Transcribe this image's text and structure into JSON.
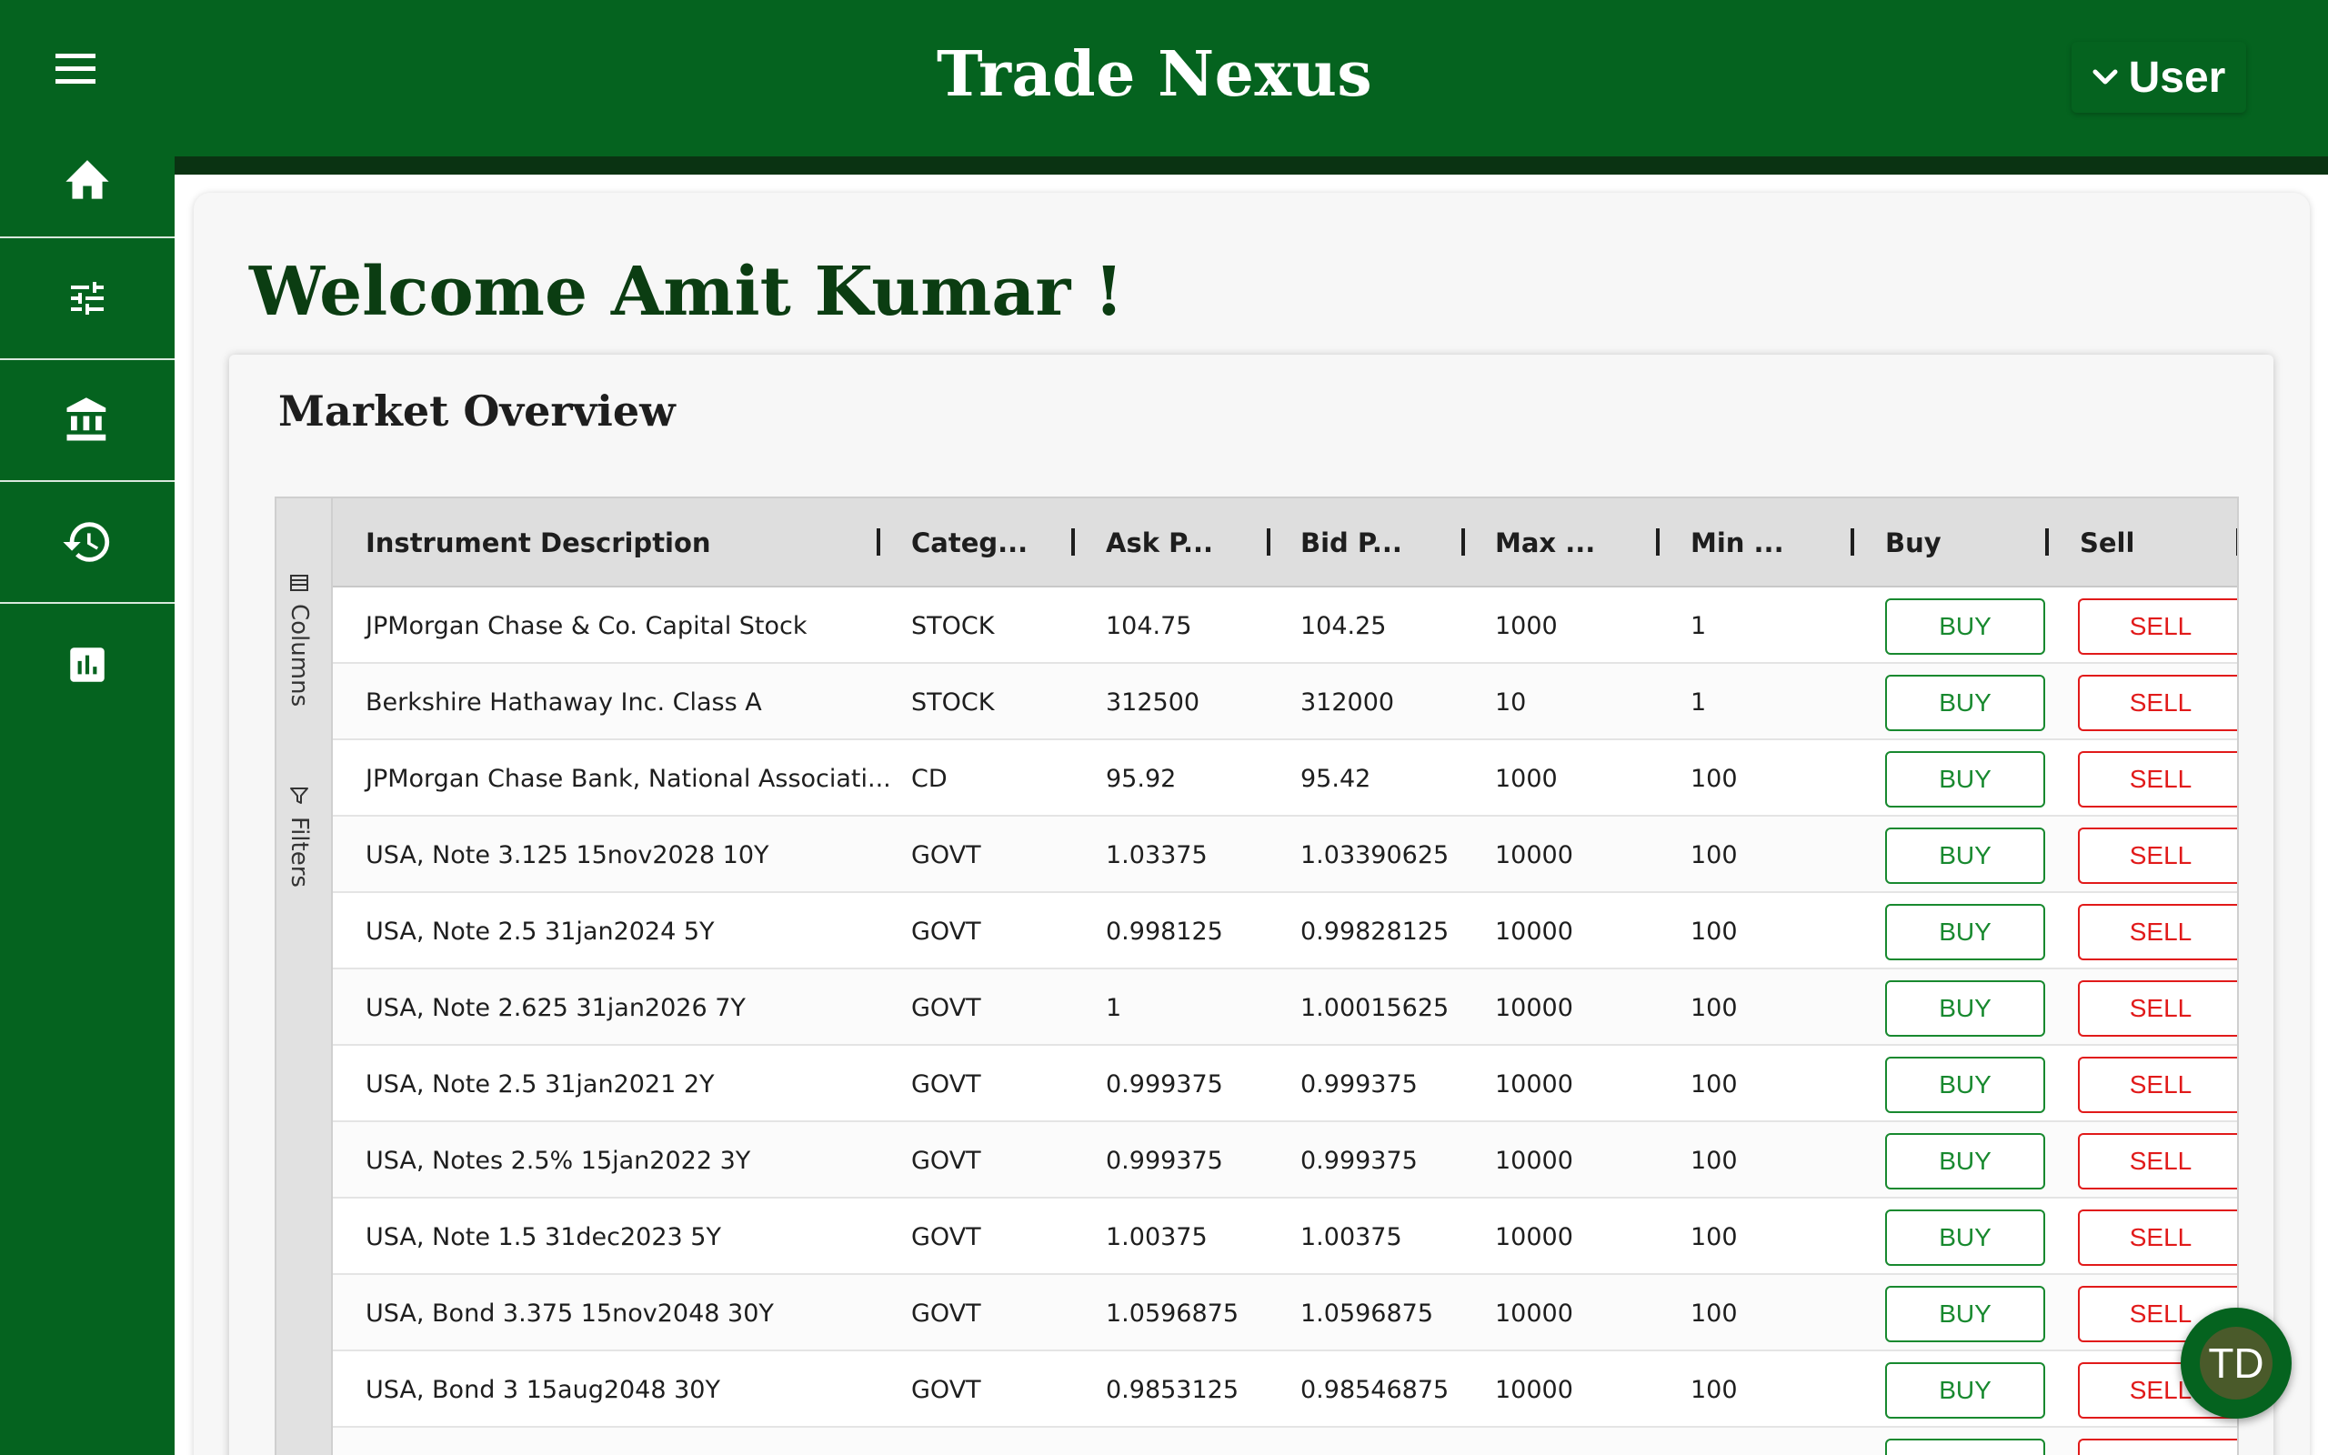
{
  "app": {
    "title": "Trade Nexus"
  },
  "user_menu": {
    "label": "User",
    "icon": "chevron-down-icon"
  },
  "sidebar": {
    "items": [
      {
        "name": "menu",
        "icon": "menu-icon"
      },
      {
        "name": "home",
        "icon": "home-icon"
      },
      {
        "name": "tune",
        "icon": "sliders-icon"
      },
      {
        "name": "bank",
        "icon": "bank-icon"
      },
      {
        "name": "history",
        "icon": "history-icon"
      },
      {
        "name": "reports",
        "icon": "bar-chart-icon"
      }
    ]
  },
  "welcome": {
    "text": "Welcome Amit Kumar !"
  },
  "market": {
    "title": "Market Overview",
    "side_tabs": {
      "columns": "Columns",
      "filters": "Filters"
    },
    "columns": [
      "Instrument Description",
      "Categ...",
      "Ask P...",
      "Bid P...",
      "Max ...",
      "Min ...",
      "Buy",
      "Sell"
    ],
    "buy_label": "BUY",
    "sell_label": "SELL",
    "rows": [
      {
        "desc": "JPMorgan Chase & Co. Capital Stock",
        "category": "STOCK",
        "ask": "104.75",
        "bid": "104.25",
        "max": "1000",
        "min": "1"
      },
      {
        "desc": "Berkshire Hathaway Inc. Class A",
        "category": "STOCK",
        "ask": "312500",
        "bid": "312000",
        "max": "10",
        "min": "1"
      },
      {
        "desc": "JPMorgan Chase Bank, National Associati...",
        "category": "CD",
        "ask": "95.92",
        "bid": "95.42",
        "max": "1000",
        "min": "100"
      },
      {
        "desc": "USA, Note 3.125 15nov2028 10Y",
        "category": "GOVT",
        "ask": "1.03375",
        "bid": "1.03390625",
        "max": "10000",
        "min": "100"
      },
      {
        "desc": "USA, Note 2.5 31jan2024 5Y",
        "category": "GOVT",
        "ask": "0.998125",
        "bid": "0.99828125",
        "max": "10000",
        "min": "100"
      },
      {
        "desc": "USA, Note 2.625 31jan2026 7Y",
        "category": "GOVT",
        "ask": "1",
        "bid": "1.00015625",
        "max": "10000",
        "min": "100"
      },
      {
        "desc": "USA, Note 2.5 31jan2021 2Y",
        "category": "GOVT",
        "ask": "0.999375",
        "bid": "0.999375",
        "max": "10000",
        "min": "100"
      },
      {
        "desc": "USA, Notes 2.5% 15jan2022 3Y",
        "category": "GOVT",
        "ask": "0.999375",
        "bid": "0.999375",
        "max": "10000",
        "min": "100"
      },
      {
        "desc": "USA, Note 1.5 31dec2023 5Y",
        "category": "GOVT",
        "ask": "1.00375",
        "bid": "1.00375",
        "max": "10000",
        "min": "100"
      },
      {
        "desc": "USA, Bond 3.375 15nov2048 30Y",
        "category": "GOVT",
        "ask": "1.0596875",
        "bid": "1.0596875",
        "max": "10000",
        "min": "100"
      },
      {
        "desc": "USA, Bond 3 15aug2048 30Y",
        "category": "GOVT",
        "ask": "0.9853125",
        "bid": "0.98546875",
        "max": "10000",
        "min": "100"
      },
      {
        "desc": "",
        "category": "",
        "ask": "",
        "bid": "",
        "max": "",
        "min": ""
      }
    ]
  },
  "fab": {
    "label": "TD"
  },
  "colors": {
    "primary": "#05631f",
    "buy": "#18892f",
    "sell": "#e11a1a",
    "heading": "#0b3d12"
  }
}
